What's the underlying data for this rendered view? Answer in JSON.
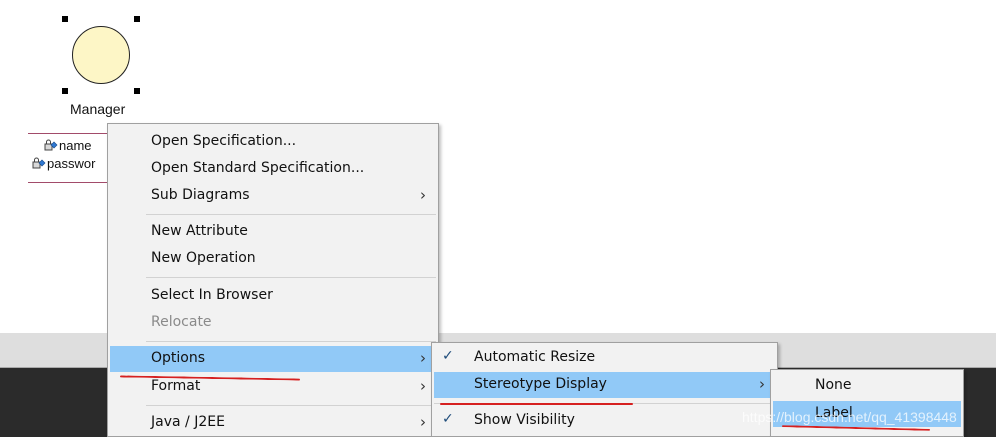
{
  "diagram": {
    "actor_label": "Manager",
    "attributes": [
      "name",
      "passwor"
    ]
  },
  "context_menu": {
    "items": [
      {
        "label": "Open Specification..."
      },
      {
        "label": "Open Standard Specification..."
      },
      {
        "label": "Sub Diagrams",
        "submenu": true
      },
      {
        "label": "New Attribute"
      },
      {
        "label": "New Operation"
      },
      {
        "label": "Select In Browser"
      },
      {
        "label": "Relocate",
        "disabled": true
      },
      {
        "label": "Options",
        "submenu": true,
        "highlighted": true
      },
      {
        "label": "Format",
        "submenu": true
      },
      {
        "label": "Java / J2EE",
        "submenu": true
      }
    ]
  },
  "options_submenu": {
    "items": [
      {
        "label": "Automatic Resize",
        "checked": true
      },
      {
        "label": "Stereotype Display",
        "submenu": true,
        "highlighted": true
      },
      {
        "label": "Show Visibility",
        "checked": true
      }
    ]
  },
  "stereotype_submenu": {
    "items": [
      {
        "label": "None"
      },
      {
        "label": "Label",
        "highlighted": true
      }
    ]
  },
  "watermark": "https://blog.csdn.net/qq_41398448",
  "colors": {
    "highlight": "#91c9f7",
    "menu_bg": "#f2f2f2",
    "actor_fill": "#fdf6c6",
    "annotation_red": "#d62020"
  }
}
